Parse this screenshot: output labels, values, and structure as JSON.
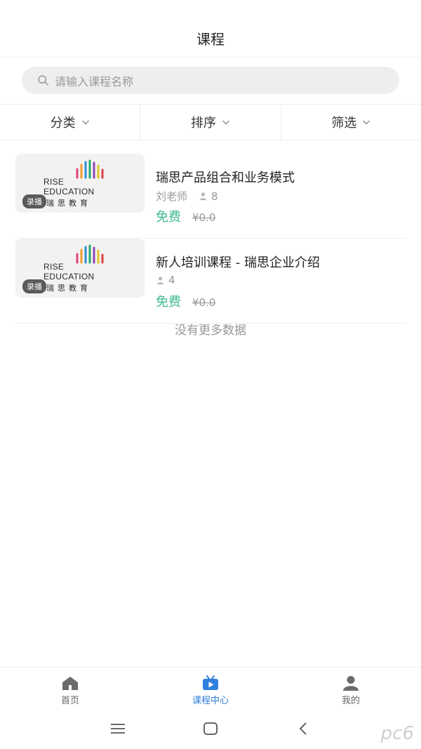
{
  "header": {
    "title": "课程"
  },
  "search": {
    "placeholder": "请输入课程名称"
  },
  "filters": [
    {
      "label": "分类"
    },
    {
      "label": "排序"
    },
    {
      "label": "筛选"
    }
  ],
  "courses": [
    {
      "title": "瑞思产品组合和业务模式",
      "teacher": "刘老师",
      "students": "8",
      "price_label": "免费",
      "original_price": "¥0.0",
      "tag": "录播",
      "thumb_text_en_1": "RISE",
      "thumb_text_en_2": "EDUCATION",
      "thumb_text_cn": "瑞思教育"
    },
    {
      "title": "新人培训课程 - 瑞思企业介绍",
      "teacher": "",
      "students": "4",
      "price_label": "免费",
      "original_price": "¥0.0",
      "tag": "录播",
      "thumb_text_en_1": "RISE",
      "thumb_text_en_2": "EDUCATION",
      "thumb_text_cn": "瑞思教育"
    }
  ],
  "list_end": "没有更多数据",
  "tabbar": {
    "items": [
      {
        "label": "首页",
        "icon": "home-icon",
        "active": false
      },
      {
        "label": "课程中心",
        "icon": "play-tv-icon",
        "active": true
      },
      {
        "label": "我的",
        "icon": "user-icon",
        "active": false
      }
    ]
  },
  "watermark": "pc6",
  "colors": {
    "accent": "#2f7fdc",
    "free": "#3fba8f"
  }
}
